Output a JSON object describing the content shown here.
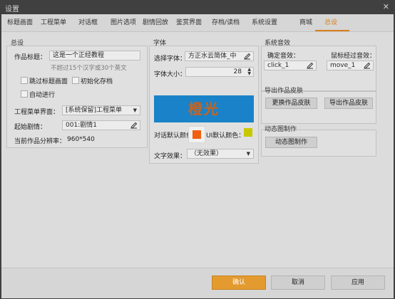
{
  "window": {
    "title": "设置",
    "close": "✕"
  },
  "tabs": [
    {
      "label": "标题画面"
    },
    {
      "label": "工程菜单"
    },
    {
      "label": "对话框"
    },
    {
      "label": "图片选项"
    },
    {
      "label": "剧情回放"
    },
    {
      "label": "鉴赏界面"
    },
    {
      "label": "存档/读档"
    },
    {
      "label": "系统设置"
    },
    {
      "label": "商城"
    },
    {
      "label": "总设"
    }
  ],
  "general": {
    "title": "总设",
    "work_title_label": "作品标题：",
    "work_title_value": "这是一个正经教程",
    "work_title_hint": "不超过15个汉字或30个英文",
    "skip_title": "跳过标题画面",
    "init_save": "初始化存档",
    "auto_run": "自动进行",
    "project_menu_label": "工程菜单界面：",
    "project_menu_value": "[系统保留]工程菜单",
    "start_story_label": "起始剧情：",
    "start_story_value": "001:剧情1",
    "resolution_label": "当前作品分辨率：",
    "resolution_value": "960*540"
  },
  "font": {
    "title": "字体",
    "select_label": "选择字体：",
    "select_value": "方正水云简体_中",
    "size_label": "字体大小：",
    "size_value": "28",
    "preview_text": "橙光",
    "dialog_color_label": "对话默认颜色：",
    "ui_color_label": "UI默认颜色：",
    "dialog_color": "#f06010",
    "ui_color": "#c8c800",
    "effect_label": "文字效果：",
    "effect_value": "（无效果）"
  },
  "sound": {
    "title": "系统音效",
    "confirm_label": "确定音效：",
    "confirm_value": "click_1",
    "hover_label": "鼠标经过音效：",
    "hover_value": "move_1"
  },
  "skin": {
    "title": "导出作品皮肤",
    "change_button": "更换作品皮肤",
    "export_button": "导出作品皮肤"
  },
  "anim": {
    "title": "动态图制作",
    "button": "动态图制作"
  },
  "footer": {
    "ok": "确认",
    "cancel": "取消",
    "apply": "应用"
  },
  "colors": {
    "accent": "#d9801c",
    "preview_bg": "#1a82c8",
    "preview_text": "#c8641e"
  }
}
